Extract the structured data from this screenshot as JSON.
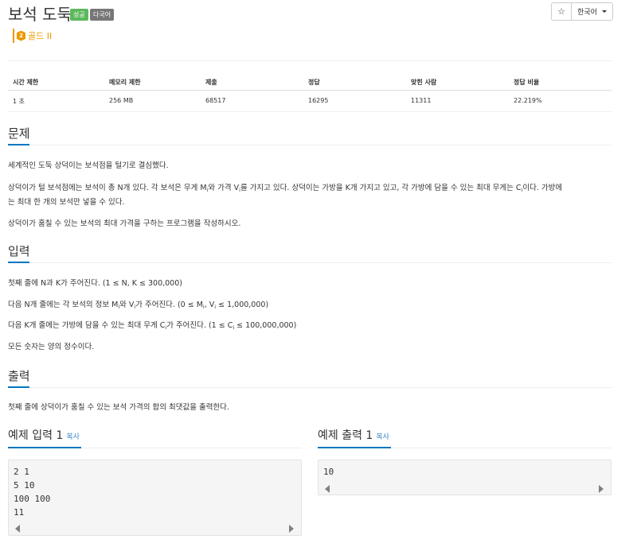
{
  "header": {
    "title": "보석 도둑",
    "badge_success": "성공",
    "badge_multilang": "다국어",
    "star_icon": "star-icon",
    "language_button": "한국어",
    "tier_label": "골드 II",
    "tier_icon": "gold-tier-icon",
    "tier_number": "2",
    "tier_color": "#ec9a00"
  },
  "info_table": {
    "headers": [
      "시간 제한",
      "메모리 제한",
      "제출",
      "정답",
      "맞힌 사람",
      "정답 비율"
    ],
    "values": [
      "1 초",
      "256 MB",
      "68517",
      "16295",
      "11311",
      "22.219%"
    ]
  },
  "problem": {
    "title": "문제",
    "p1": "세계적인 도둑 상덕이는 보석점을 털기로 결심했다.",
    "p2_a": "상덕이가 털 보석점에는 보석이 총 N개 있다. 각 보석은 무게 M",
    "p2_b": "와 가격 V",
    "p2_c": "를 가지고 있다. 상덕이는 가방을 K개 가지고 있고, 각 가방에 담을 수 있는 최대 무게는 C",
    "p2_d": "이다. 가방에",
    "p2_e": "는 최대 한 개의 보석만 넣을 수 있다.",
    "p3": "상덕이가 훔칠 수 있는 보석의 최대 가격을 구하는 프로그램을 작성하시오.",
    "sub_i": "i"
  },
  "input": {
    "title": "입력",
    "p1": "첫째 줄에 N과 K가 주어진다. (1 ≤ N, K ≤ 300,000)",
    "p2_a": "다음 N개 줄에는 각 보석의 정보 M",
    "p2_b": "와 V",
    "p2_c": "가 주어진다. (0 ≤ M",
    "p2_d": ", V",
    "p2_e": " ≤ 1,000,000)",
    "p3_a": "다음 K개 줄에는 가방에 담을 수 있는 최대 무게 C",
    "p3_b": "가 주어진다. (1 ≤ C",
    "p3_c": " ≤ 100,000,000)",
    "p4": "모든 숫자는 양의 정수이다."
  },
  "output": {
    "title": "출력",
    "p1": "첫째 줄에 상덕이가 훔칠 수 있는 보석 가격의 합의 최댓값을 출력한다."
  },
  "sample_input": {
    "title": "예제 입력 1",
    "copy": "복사",
    "lines": [
      "2 1",
      "5 10",
      "100 100",
      "11"
    ]
  },
  "sample_output": {
    "title": "예제 출력 1",
    "copy": "복사",
    "lines": [
      "10"
    ]
  },
  "colors": {
    "accent": "#0076c0",
    "success": "#5cb85c",
    "muted_badge": "#777777",
    "link": "#428bca"
  }
}
